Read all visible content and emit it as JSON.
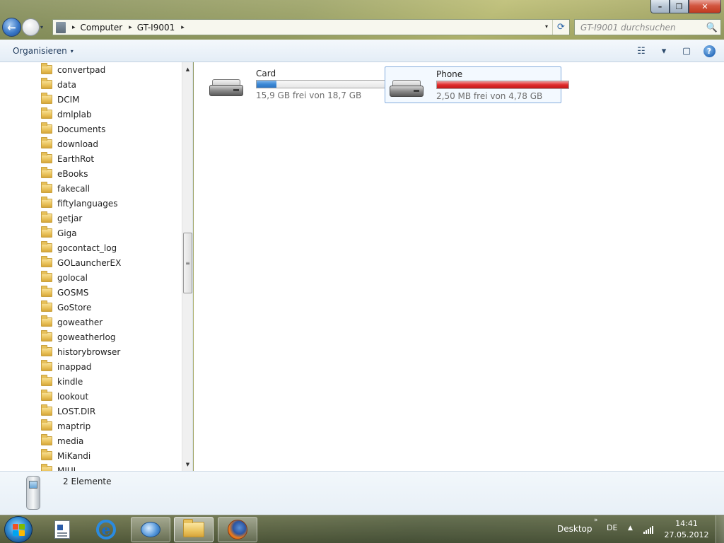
{
  "window": {
    "caption": {
      "minimize": "–",
      "maximize": "❐",
      "close": "✕"
    }
  },
  "navigation": {
    "back_icon": "back-arrow-icon",
    "forward_icon": "forward-arrow-icon",
    "recent_pages_icon": "chevron-down-icon",
    "address": {
      "separator": "▸",
      "crumbs": [
        "Computer",
        "GT-I9001"
      ]
    },
    "address_dropdown": "▾",
    "refresh": "⟳"
  },
  "search": {
    "placeholder": "GT-I9001 durchsuchen",
    "icon": "🔍"
  },
  "commandbar": {
    "organize_label": "Organisieren",
    "organize_caret": "▾",
    "view_icon": "☷",
    "view_caret": "▾",
    "preview_icon": "▢",
    "help_icon": "?"
  },
  "navpane": {
    "folders": [
      "convertpad",
      "data",
      "DCIM",
      "dmlplab",
      "Documents",
      "download",
      "EarthRot",
      "eBooks",
      "fakecall",
      "fiftylanguages",
      "getjar",
      "Giga",
      "gocontact_log",
      "GOLauncherEX",
      "golocal",
      "GOSMS",
      "GoStore",
      "goweather",
      "goweatherlog",
      "historybrowser",
      "inappad",
      "kindle",
      "lookout",
      "LOST.DIR",
      "maptrip",
      "media",
      "MiKandi",
      "MIUI"
    ],
    "scroll_up": "▲",
    "scroll_down": "▼",
    "scroll_grip": "≡",
    "scroll_position": 0.49
  },
  "drives": [
    {
      "name": "Card",
      "free": "15,9 GB frei von 18,7 GB",
      "used_fraction": 0.15,
      "state": "normal"
    },
    {
      "name": "Phone",
      "free": "2,50 MB frei von 4,78 GB",
      "used_fraction": 0.999,
      "state": "full"
    }
  ],
  "details": {
    "count": "2 Elemente"
  },
  "taskbar": {
    "start_icon": "windows-logo-icon",
    "apps": [
      "document-app-icon",
      "internet-explorer-icon",
      "mail-client-icon",
      "windows-explorer-icon",
      "firefox-icon"
    ],
    "desktop_label": "Desktop",
    "tray_separator": "»",
    "language": "DE",
    "tray_arrow": "▲",
    "time": "14:41",
    "date": "27.05.2012"
  },
  "colors": {
    "usage_normal": "#3c89d6",
    "usage_full": "#df2b2b",
    "selection_border": "#84acdd",
    "windows_logo": [
      "#f25022",
      "#7fba00",
      "#00a4ef",
      "#ffb900"
    ]
  }
}
